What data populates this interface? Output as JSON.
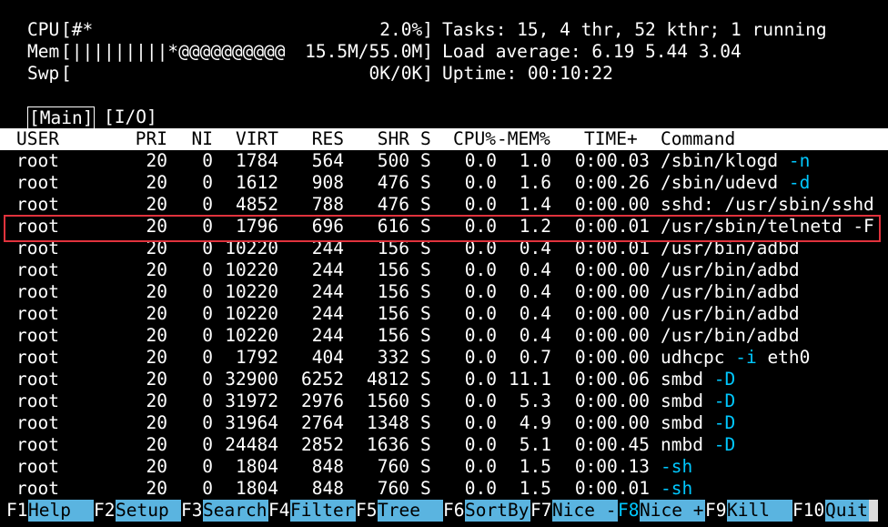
{
  "meters": {
    "cpu": {
      "label": "CPU",
      "bar": "[#*",
      "value": "2.0%]"
    },
    "mem": {
      "label": "Mem",
      "bar": "[|||||||||*@@@@@@@@@@",
      "value": "15.5M/55.0M]"
    },
    "swp": {
      "label": "Swp",
      "bar": "[",
      "value": "0K/0K]"
    }
  },
  "summary": {
    "tasks": "Tasks: 15, 4 thr, 52 kthr; 1 running",
    "load": "Load average: 6.19 5.44 3.04",
    "uptime": "Uptime: 00:10:22"
  },
  "tabs": {
    "main": "[Main]",
    "io": "[I/O]"
  },
  "columns": [
    "USER",
    "PRI",
    "NI",
    "VIRT",
    "RES",
    "SHR",
    "S",
    "CPU%",
    "-MEM%",
    "TIME+",
    "Command"
  ],
  "selected_row_index": 3,
  "processes": [
    {
      "user": "root",
      "pri": "20",
      "ni": "0",
      "virt": "1784",
      "res": "564",
      "shr": "500",
      "s": "S",
      "cpu": "0.0",
      "mem": "1.0",
      "time": "0:00.03",
      "cmd": "/sbin/klogd",
      "args": "-n"
    },
    {
      "user": "root",
      "pri": "20",
      "ni": "0",
      "virt": "1612",
      "res": "908",
      "shr": "476",
      "s": "S",
      "cpu": "0.0",
      "mem": "1.6",
      "time": "0:00.26",
      "cmd": "/sbin/udevd",
      "args": "-d"
    },
    {
      "user": "root",
      "pri": "20",
      "ni": "0",
      "virt": "4852",
      "res": "788",
      "shr": "476",
      "s": "S",
      "cpu": "0.0",
      "mem": "1.4",
      "time": "0:00.00",
      "cmd": "sshd: /usr/sbin/sshd",
      "args": ""
    },
    {
      "user": "root",
      "pri": "20",
      "ni": "0",
      "virt": "1796",
      "res": "696",
      "shr": "616",
      "s": "S",
      "cpu": "0.0",
      "mem": "1.2",
      "time": "0:00.01",
      "cmd": "/usr/sbin/telnetd -F",
      "args": ""
    },
    {
      "user": "root",
      "pri": "20",
      "ni": "0",
      "virt": "10220",
      "res": "244",
      "shr": "156",
      "s": "S",
      "cpu": "0.0",
      "mem": "0.4",
      "time": "0:00.01",
      "cmd": "/usr/bin/adbd",
      "args": ""
    },
    {
      "user": "root",
      "pri": "20",
      "ni": "0",
      "virt": "10220",
      "res": "244",
      "shr": "156",
      "s": "S",
      "cpu": "0.0",
      "mem": "0.4",
      "time": "0:00.00",
      "cmd": "/usr/bin/adbd",
      "args": ""
    },
    {
      "user": "root",
      "pri": "20",
      "ni": "0",
      "virt": "10220",
      "res": "244",
      "shr": "156",
      "s": "S",
      "cpu": "0.0",
      "mem": "0.4",
      "time": "0:00.00",
      "cmd": "/usr/bin/adbd",
      "args": ""
    },
    {
      "user": "root",
      "pri": "20",
      "ni": "0",
      "virt": "10220",
      "res": "244",
      "shr": "156",
      "s": "S",
      "cpu": "0.0",
      "mem": "0.4",
      "time": "0:00.00",
      "cmd": "/usr/bin/adbd",
      "args": ""
    },
    {
      "user": "root",
      "pri": "20",
      "ni": "0",
      "virt": "10220",
      "res": "244",
      "shr": "156",
      "s": "S",
      "cpu": "0.0",
      "mem": "0.4",
      "time": "0:00.00",
      "cmd": "/usr/bin/adbd",
      "args": ""
    },
    {
      "user": "root",
      "pri": "20",
      "ni": "0",
      "virt": "1792",
      "res": "404",
      "shr": "332",
      "s": "S",
      "cpu": "0.0",
      "mem": "0.7",
      "time": "0:00.00",
      "cmd": "udhcpc",
      "args": "-i",
      "tail": "eth0"
    },
    {
      "user": "root",
      "pri": "20",
      "ni": "0",
      "virt": "32900",
      "res": "6252",
      "shr": "4812",
      "s": "S",
      "cpu": "0.0",
      "mem": "11.1",
      "time": "0:00.06",
      "cmd": "smbd",
      "args": "-D"
    },
    {
      "user": "root",
      "pri": "20",
      "ni": "0",
      "virt": "31972",
      "res": "2976",
      "shr": "1560",
      "s": "S",
      "cpu": "0.0",
      "mem": "5.3",
      "time": "0:00.00",
      "cmd": "smbd",
      "args": "-D"
    },
    {
      "user": "root",
      "pri": "20",
      "ni": "0",
      "virt": "31964",
      "res": "2764",
      "shr": "1348",
      "s": "S",
      "cpu": "0.0",
      "mem": "4.9",
      "time": "0:00.00",
      "cmd": "smbd",
      "args": "-D"
    },
    {
      "user": "root",
      "pri": "20",
      "ni": "0",
      "virt": "24484",
      "res": "2852",
      "shr": "1636",
      "s": "S",
      "cpu": "0.0",
      "mem": "5.1",
      "time": "0:00.45",
      "cmd": "nmbd",
      "args": "-D"
    },
    {
      "user": "root",
      "pri": "20",
      "ni": "0",
      "virt": "1804",
      "res": "848",
      "shr": "760",
      "s": "S",
      "cpu": "0.0",
      "mem": "1.5",
      "time": "0:00.13",
      "cmd": "",
      "args": "-sh"
    },
    {
      "user": "root",
      "pri": "20",
      "ni": "0",
      "virt": "1804",
      "res": "848",
      "shr": "760",
      "s": "S",
      "cpu": "0.0",
      "mem": "1.5",
      "time": "0:00.01",
      "cmd": "",
      "args": "-sh"
    }
  ],
  "function_keys": [
    {
      "key": "F1",
      "label": "Help"
    },
    {
      "key": "F2",
      "label": "Setup"
    },
    {
      "key": "F3",
      "label": "Search"
    },
    {
      "key": "F4",
      "label": "Filter"
    },
    {
      "key": "F5",
      "label": "Tree"
    },
    {
      "key": "F6",
      "label": "SortBy"
    },
    {
      "key": "F7",
      "label": "Nice -"
    },
    {
      "key": "F8",
      "label": "Nice +"
    },
    {
      "key": "F9",
      "label": "Kill"
    },
    {
      "key": "F10",
      "label": "Quit"
    }
  ],
  "colors": {
    "accent": "#00c8ff",
    "label_bg": "#5ab4e0",
    "header_bg": "#ffffff",
    "selection_border": "#e0323c"
  }
}
